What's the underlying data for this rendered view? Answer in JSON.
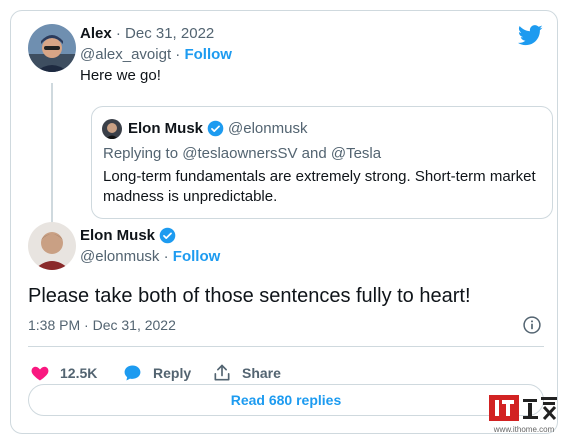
{
  "reply_tweet": {
    "display_name": "Alex",
    "date": "Dec 31, 2022",
    "handle": "@alex_avoigt",
    "follow_label": "Follow",
    "text": "Here we go!"
  },
  "quoted_tweet": {
    "display_name": "Elon Musk",
    "handle": "@elonmusk",
    "replying_to": "Replying to @teslaownersSV and @Tesla",
    "text": "Long-term fundamentals are extremely strong. Short-term market madness is unpredictable."
  },
  "main_tweet": {
    "display_name": "Elon Musk",
    "handle": "@elonmusk",
    "follow_label": "Follow",
    "text": "Please take both of those sentences fully to heart!",
    "timestamp": "1:38 PM · Dec 31, 2022"
  },
  "actions": {
    "likes_count": "12.5K",
    "reply_label": "Reply",
    "share_label": "Share",
    "read_replies_label": "Read 680 replies"
  },
  "watermark": {
    "logo_text": "IT之家",
    "url": "www.ithome.com"
  },
  "colors": {
    "accent": "#1d9bf0",
    "like": "#f91880",
    "text": "#0f1419",
    "muted": "#536471",
    "border": "#cfd9de",
    "watermark_red": "#d22222"
  }
}
